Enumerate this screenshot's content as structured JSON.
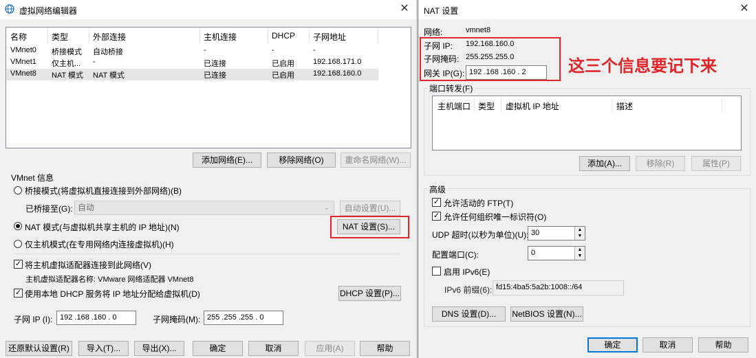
{
  "left": {
    "title": "虚拟网络编辑器",
    "table": {
      "headers": [
        "名称",
        "类型",
        "外部连接",
        "主机连接",
        "DHCP",
        "子网地址"
      ],
      "rows": [
        [
          "VMnet0",
          "桥接模式",
          "自动桥接",
          "-",
          "-",
          "-"
        ],
        [
          "VMnet1",
          "仅主机...",
          "-",
          "已连接",
          "已启用",
          "192.168.171.0"
        ],
        [
          "VMnet8",
          "NAT 模式",
          "NAT 模式",
          "已连接",
          "已启用",
          "192.168.160.0"
        ]
      ]
    },
    "buttons": {
      "add_network": "添加网络(E)...",
      "remove_network": "移除网络(O)",
      "rename_network": "重命名网络(W)..."
    },
    "vmnet_info": {
      "label": "VMnet 信息",
      "bridge_mode": "桥接模式(将虚拟机直接连接到外部网络)(B)",
      "bridged_to_label": "已桥接至(G):",
      "bridged_to_value": "自动",
      "auto_settings": "自动设置(U)...",
      "nat_mode": "NAT 模式(与虚拟机共享主机的 IP 地址)(N)",
      "nat_settings": "NAT 设置(S)...",
      "host_only": "仅主机模式(在专用网络内连接虚拟机)(H)",
      "connect_adapter": "将主机虚拟适配器连接到此网络(V)",
      "adapter_name": "主机虚拟适配器名称: VMware 网络适配器 VMnet8",
      "use_dhcp": "使用本地 DHCP 服务将 IP 地址分配给虚拟机(D)",
      "dhcp_settings": "DHCP 设置(P)...",
      "subnet_ip_label": "子网 IP (I):",
      "subnet_ip": "192 .168 .160 .  0",
      "subnet_mask_label": "子网掩码(M):",
      "subnet_mask": "255 .255 .255 .  0"
    },
    "bottom": {
      "restore": "还原默认设置(R)",
      "import": "导入(T)...",
      "export": "导出(X)...",
      "ok": "确定",
      "cancel": "取消",
      "apply": "应用(A)",
      "help": "帮助"
    }
  },
  "right": {
    "title": "NAT 设置",
    "network_label": "网络:",
    "network_value": "vmnet8",
    "subnet_ip_label": "子网 IP:",
    "subnet_ip_value": "192.168.160.0",
    "subnet_mask_label": "子网掩码:",
    "subnet_mask_value": "255.255.255.0",
    "gateway_label": "网关 IP(G):",
    "gateway_value": " 192 .168 .160 .  2",
    "annotation": "这三个信息要记下来",
    "port_forward_label": "端口转发(F)",
    "pf_headers": [
      "主机端口",
      "类型",
      "虚拟机 IP 地址",
      "描述"
    ],
    "pf_buttons": {
      "add": "添加(A)...",
      "remove": "移除(R)",
      "properties": "属性(P)"
    },
    "advanced_label": "高级",
    "allow_ftp": "允许活动的 FTP(T)",
    "allow_uid": "允许任何组织唯一标识符(O)",
    "udp_timeout_label": "UDP 超时(以秒为单位)(U):",
    "udp_timeout_value": "30",
    "config_port_label": "配置端口(C):",
    "config_port_value": "0",
    "enable_ipv6": "启用 IPv6(E)",
    "ipv6_prefix_label": "IPv6 前缀(6):",
    "ipv6_prefix_value": "fd15:4ba5:5a2b:1008::/64",
    "dns_settings": "DNS 设置(D)...",
    "netbios_settings": "NetBIOS 设置(N)...",
    "ok": "确定",
    "cancel": "取消",
    "help": "帮助",
    "colors": {
      "annotation": "#e0252b",
      "highlight": "#e0252b",
      "accent": "#0078d7"
    }
  }
}
